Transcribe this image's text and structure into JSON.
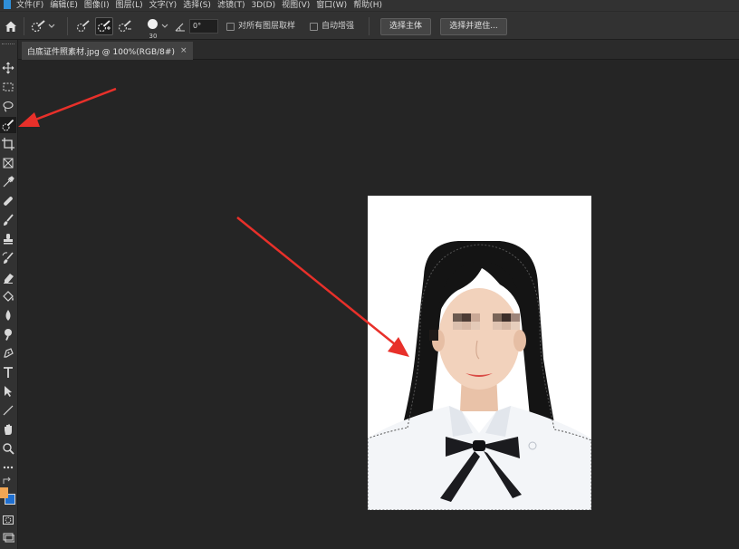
{
  "menu": {
    "items": [
      "文件(F)",
      "编辑(E)",
      "图像(I)",
      "图层(L)",
      "文字(Y)",
      "选择(S)",
      "滤镜(T)",
      "3D(D)",
      "视图(V)",
      "窗口(W)",
      "帮助(H)"
    ]
  },
  "options": {
    "tool_icon": "quick-selection-icon",
    "brush_size": "30",
    "angle_value": "0°",
    "sample_all_layers_label": "对所有图层取样",
    "auto_enhance_label": "自动增强",
    "select_subject_label": "选择主体",
    "select_and_mask_label": "选择并遮住..."
  },
  "document": {
    "tab_title": "白底证件照素材.jpg @ 100%(RGB/8#)",
    "close_glyph": "×"
  },
  "tools": [
    "move-icon",
    "marquee-icon",
    "lasso-icon",
    "quick-selection-icon",
    "crop-icon",
    "frame-icon",
    "eyedropper-icon",
    "healing-brush-icon",
    "brush-icon",
    "stamp-icon",
    "history-brush-icon",
    "eraser-icon",
    "paint-bucket-icon",
    "blur-icon",
    "dodge-icon",
    "pen-icon",
    "type-icon",
    "path-selection-icon",
    "line-icon",
    "hand-icon",
    "zoom-icon",
    "more-tools-icon"
  ],
  "colors": {
    "foreground": "#f2a654",
    "background": "#1f6fd0",
    "annotation_arrow": "#e8302a",
    "canvas_bg": "#252525"
  }
}
